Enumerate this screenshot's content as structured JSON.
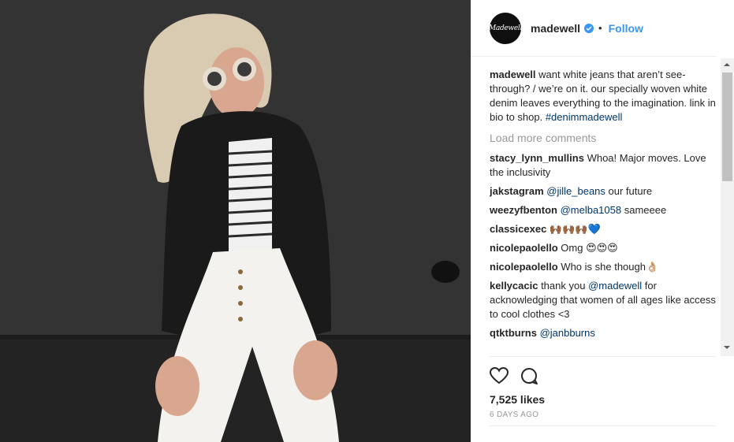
{
  "header": {
    "avatar_text": "Madewell",
    "username": "madewell",
    "separator": "•",
    "follow_label": "Follow"
  },
  "caption": {
    "username": "madewell",
    "text": " want white jeans that aren’t see-through? / we’re on it. our specially woven white denim leaves everything to the imagination. link in bio to shop. ",
    "hashtag": "#denimmadewell"
  },
  "load_more": "Load more comments",
  "comments": [
    {
      "user": "stacy_lynn_mullins",
      "text": " Whoa! Major moves. Love the inclusivity",
      "mention": ""
    },
    {
      "user": "jakstagram",
      "text": "",
      "mention": " @jille_beans",
      "after": " our future"
    },
    {
      "user": "weezyfbenton",
      "text": "",
      "mention": " @melba1058",
      "after": " sameeee"
    },
    {
      "user": "classicexec",
      "text": " 🙌🏾🙌🏾🙌🏾💙"
    },
    {
      "user": "nicolepaolello",
      "text": " Omg 😍😍😍"
    },
    {
      "user": "nicolepaolello",
      "text": " Who is she though👌🏼"
    },
    {
      "user": "kellycacic",
      "text": " thank you ",
      "mention": "@madewell",
      "after": " for acknowledging that women of all ages like access to cool clothes <3"
    },
    {
      "user": "qtktburns",
      "text": "",
      "mention": " @janbburns",
      "after": ""
    }
  ],
  "likes": "7,525 likes",
  "timestamp": "6 DAYS AGO",
  "icons": {
    "like": "heart-icon",
    "comment": "comment-bubble-icon",
    "verified": "verified-badge-icon"
  },
  "colors": {
    "accent": "#3897f0",
    "mention": "#003569",
    "muted": "#999999"
  }
}
